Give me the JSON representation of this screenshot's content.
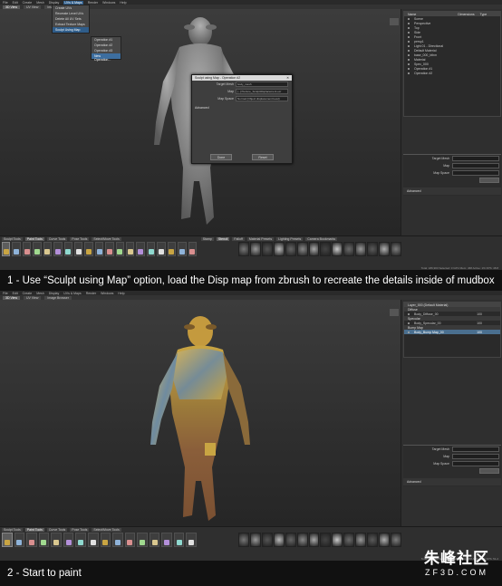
{
  "top": {
    "menubar": [
      "File",
      "Edit",
      "Create",
      "Mesh",
      "Display",
      "UVs & Maps",
      "Render",
      "Windows",
      "Help"
    ],
    "tabs": [
      "3D View",
      "UV View",
      "Image Browser"
    ],
    "menu": {
      "items": [
        "Create UVs",
        "Recreate Level UVs",
        "Delete All UV Sets",
        "Extract Texture Maps",
        "Sculpt Using Map"
      ],
      "hl_index": 4,
      "submenu": [
        "Operation #1",
        "Operation #2",
        "Operation #3",
        "New Operation..."
      ],
      "sub_hl_index": 3
    },
    "dialog": {
      "title": "Sculpt using Map - Operation #2",
      "fields": [
        {
          "label": "Target Mesh",
          "value": "body_mesh"
        },
        {
          "label": "Map",
          "value": "[...]/Texture_Sculpt/displacement.exr"
        },
        {
          "label": "Map Space",
          "value": "Normal (Object displacement level)"
        }
      ],
      "advanced": "Advanced",
      "ok": "Done",
      "cancel": "Reset"
    },
    "outliner": {
      "headers": [
        "Name",
        "Dimensions",
        "Type"
      ],
      "rows": [
        "Scene",
        "Perspective",
        "Top",
        "Side",
        "Front",
        "persp1",
        "Light 01 - Directional",
        "Default Material",
        "base_000_bthm",
        "Material",
        "Spec_000",
        "Operation #1",
        "Operation #2"
      ],
      "sel_index": -1
    },
    "properties": {
      "target": "Target Mesh",
      "map": "Map",
      "map_space": "Map Space",
      "advanced": "Advanced"
    },
    "tray_tabs": [
      "Sculpt Tools",
      "Paint Tools",
      "Curve Tools",
      "Pose Tools",
      "Select/Move Tools"
    ],
    "tray_tabs2": [
      "Stamp",
      "Stencil",
      "Falloff",
      "Material Presets",
      "Lighting Presets",
      "Camera Bookmarks"
    ],
    "tools": [
      "Sculpt",
      "Smooth",
      "Relax",
      "Grab",
      "Pinch",
      "Flatten",
      "Foamy",
      "Spray",
      "Repeat",
      "Imprint",
      "Wax",
      "Scrape",
      "Fill",
      "Knife",
      "Smear",
      "Bulge",
      "Amplify",
      "Freeze",
      "Mask",
      "Erase"
    ],
    "status": "Total: 186,903  Selected: 0  GPU Mem: 468  Active: 1%  FPS: 48.8"
  },
  "caption1": "1 - Use “Sculpt using Map” option, load the Disp map from zbrush to recreate the details inside of mudbox",
  "bottom": {
    "menubar": [
      "File",
      "Edit",
      "Create",
      "Mesh",
      "Display",
      "UVs & Maps",
      "Render",
      "Windows",
      "Help"
    ],
    "tabs": [
      "3D View",
      "UV View",
      "Image Browser"
    ],
    "layers": {
      "title": "Layer_000 (Default Material)",
      "sections": [
        "Diffuse",
        "Specular",
        "Bump Map"
      ],
      "rows": [
        "Body_Diffuse_00",
        "Body_Specular_00",
        "Body_Bump Map_00"
      ],
      "values": [
        "100",
        "100",
        "100"
      ]
    },
    "tray_tabs": [
      "Sculpt Tools",
      "Paint Tools",
      "Curve Tools",
      "Pose Tools",
      "Select/Move Tools"
    ],
    "tools": [
      "Paint Brush",
      "Projection",
      "Airbrush",
      "Pencil",
      "Paint Erase",
      "Clone",
      "Blur",
      "Dodge",
      "Burn",
      "Contrast",
      "Sponge",
      "Hue",
      "Hue Shift",
      "Invert",
      "Color",
      "Flood"
    ],
    "status": "Total: 186,903  Selected: 0  GPU Mem: 468  Active: 1%  FPS: 51.2"
  },
  "caption2": "2 - Start to paint",
  "watermark": {
    "cn": "朱峰社区",
    "en": "ZF3D.COM"
  },
  "colors": {
    "skin": "#8b8b8b",
    "paint_gold": "#c9a543",
    "paint_blue": "#6f8ba0",
    "select": "#4a6f8f"
  }
}
